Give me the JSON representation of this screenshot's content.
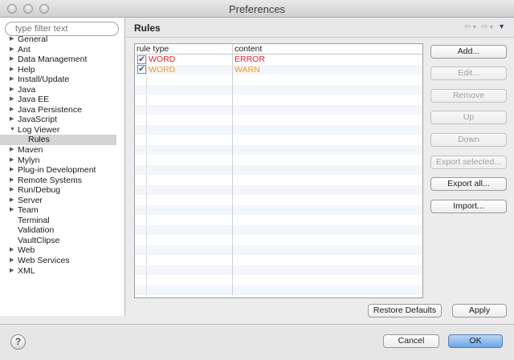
{
  "window": {
    "title": "Preferences"
  },
  "filter": {
    "placeholder": "type filter text"
  },
  "tree": [
    {
      "label": "General",
      "expandable": true,
      "level": 0
    },
    {
      "label": "Ant",
      "expandable": true,
      "level": 0
    },
    {
      "label": "Data Management",
      "expandable": true,
      "level": 0
    },
    {
      "label": "Help",
      "expandable": true,
      "level": 0
    },
    {
      "label": "Install/Update",
      "expandable": true,
      "level": 0
    },
    {
      "label": "Java",
      "expandable": true,
      "level": 0
    },
    {
      "label": "Java EE",
      "expandable": true,
      "level": 0
    },
    {
      "label": "Java Persistence",
      "expandable": true,
      "level": 0
    },
    {
      "label": "JavaScript",
      "expandable": true,
      "level": 0
    },
    {
      "label": "Log Viewer",
      "expandable": true,
      "expanded": true,
      "level": 0
    },
    {
      "label": "Rules",
      "expandable": false,
      "level": 1,
      "selected": true
    },
    {
      "label": "Maven",
      "expandable": true,
      "level": 0
    },
    {
      "label": "Mylyn",
      "expandable": true,
      "level": 0
    },
    {
      "label": "Plug-in Development",
      "expandable": true,
      "level": 0
    },
    {
      "label": "Remote Systems",
      "expandable": true,
      "level": 0
    },
    {
      "label": "Run/Debug",
      "expandable": true,
      "level": 0
    },
    {
      "label": "Server",
      "expandable": true,
      "level": 0
    },
    {
      "label": "Team",
      "expandable": true,
      "level": 0
    },
    {
      "label": "Terminal",
      "expandable": false,
      "level": 0
    },
    {
      "label": "Validation",
      "expandable": false,
      "level": 0
    },
    {
      "label": "VaultClipse",
      "expandable": false,
      "level": 0
    },
    {
      "label": "Web",
      "expandable": true,
      "level": 0
    },
    {
      "label": "Web Services",
      "expandable": true,
      "level": 0
    },
    {
      "label": "XML",
      "expandable": true,
      "level": 0
    }
  ],
  "page": {
    "title": "Rules"
  },
  "table": {
    "headers": [
      "rule type",
      "content"
    ],
    "rows": [
      {
        "checked": true,
        "type": "WORD",
        "content": "ERROR",
        "color": "#e8262a"
      },
      {
        "checked": true,
        "type": "WORD",
        "content": "WARN",
        "color": "#f59a1d"
      }
    ]
  },
  "buttons": {
    "add": "Add...",
    "edit": "Edit...",
    "remove": "Remove",
    "up": "Up",
    "down": "Down",
    "export_selected": "Export selected...",
    "export_all": "Export all...",
    "import": "Import...",
    "restore_defaults": "Restore Defaults",
    "apply": "Apply",
    "cancel": "Cancel",
    "ok": "OK"
  },
  "icons": {
    "help": "?",
    "check": "✔",
    "expand": "▶",
    "collapse": "▼",
    "back": "⇦",
    "forward": "⇨",
    "menu": "▼"
  }
}
